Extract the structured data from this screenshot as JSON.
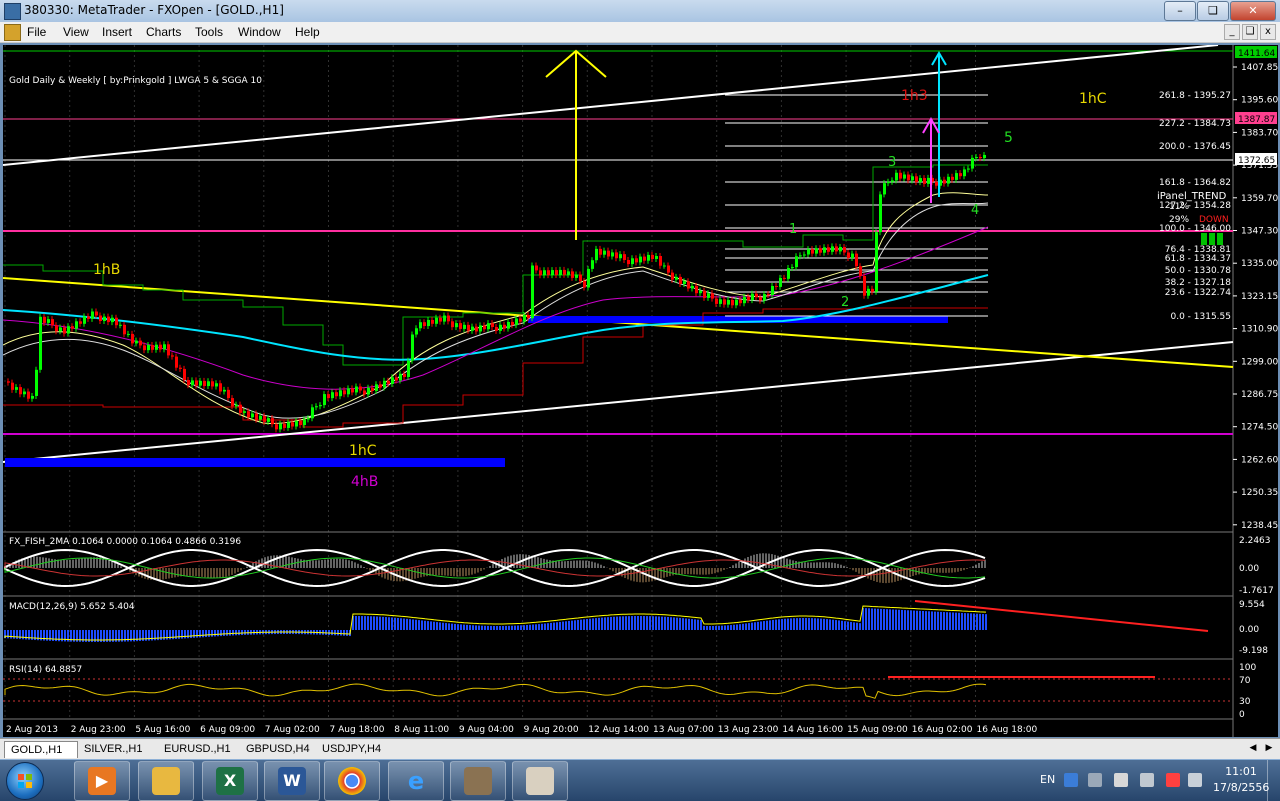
{
  "window": {
    "title": "380330: MetaTrader - FXOpen - [GOLD.,H1]"
  },
  "menu": [
    "File",
    "View",
    "Insert",
    "Charts",
    "Tools",
    "Window",
    "Help"
  ],
  "chart": {
    "indicator_label": "Gold Daily & Weekly [ by:Prinkgold ] LWGA 5  &  SGGA 10",
    "price_axis": [
      "1407.85",
      "1395.60",
      "1383.70",
      "1371.55",
      "1359.70",
      "1347.30",
      "1335.00",
      "1323.15",
      "1310.90",
      "1299.00",
      "1286.75",
      "1274.50",
      "1262.60",
      "1250.35",
      "1238.45"
    ],
    "tags": {
      "top": "1411.64",
      "pink": "1387.87",
      "current": "1372.65"
    },
    "fib_levels": [
      "261.8 - 1395.27",
      "227.2 - 1384.73",
      "200.0 - 1376.45",
      "161.8 - 1364.82",
      "127.2 - 1354.28",
      "100.0 - 1346.00",
      "76.4 - 1338.81",
      "61.8 - 1334.37",
      "50.0 - 1330.78",
      "38.2 - 1327.18",
      "23.6 - 1322.74",
      "0.0 - 1315.55"
    ],
    "panel": {
      "title": "iPanel_TREND",
      "pct1": "11%",
      "pct2": "29%",
      "direction": "DOWN"
    },
    "annotations": {
      "l1hB": "1hB",
      "l1hC_low": "1hC",
      "l4hB": "4hB",
      "l1h3": "1h3",
      "l1hC_top": "1hC",
      "w1": "1",
      "w2": "2",
      "w3": "3",
      "w4": "4",
      "w5": "5"
    },
    "fisher": {
      "label": "FX_FISH_2MA 0.1064 0.0000 0.1064 0.4866 0.3196",
      "axis": [
        "2.2463",
        "0.00",
        "-1.7617"
      ]
    },
    "macd": {
      "label": "MACD(12,26,9) 5.652 5.404",
      "axis": [
        "9.554",
        "0.00",
        "-9.198"
      ]
    },
    "rsi": {
      "label": "RSI(14) 64.8857",
      "axis": [
        "100",
        "70",
        "30",
        "0"
      ]
    },
    "time_axis": [
      "2 Aug 2013",
      "2 Aug 23:00",
      "5 Aug 16:00",
      "6 Aug 09:00",
      "7 Aug 02:00",
      "7 Aug 18:00",
      "8 Aug 11:00",
      "9 Aug 04:00",
      "9 Aug 20:00",
      "12 Aug 14:00",
      "13 Aug 07:00",
      "13 Aug 23:00",
      "14 Aug 16:00",
      "15 Aug 09:00",
      "16 Aug 02:00",
      "16 Aug 18:00"
    ],
    "colors": {
      "bull": "#00ff00",
      "bear": "#ff0000",
      "ma_cyan": "#00e5ff",
      "ma_magenta": "#d000d0",
      "trend_yellow": "#ffff00",
      "trend_white": "#ffffff",
      "zone_blue": "#0000ff"
    }
  },
  "chart_tabs": [
    "GOLD.,H1",
    "SILVER.,H1",
    "EURUSD.,H1",
    "GBPUSD,H4",
    "USDJPY,H4"
  ],
  "taskbar": {
    "icons": [
      "media-player-icon",
      "folder-icon",
      "excel-icon",
      "word-icon",
      "chrome-icon",
      "ie-icon",
      "gimp-icon",
      "paint-icon"
    ],
    "language": "EN",
    "time": "11:01",
    "date": "17/8/2556"
  }
}
